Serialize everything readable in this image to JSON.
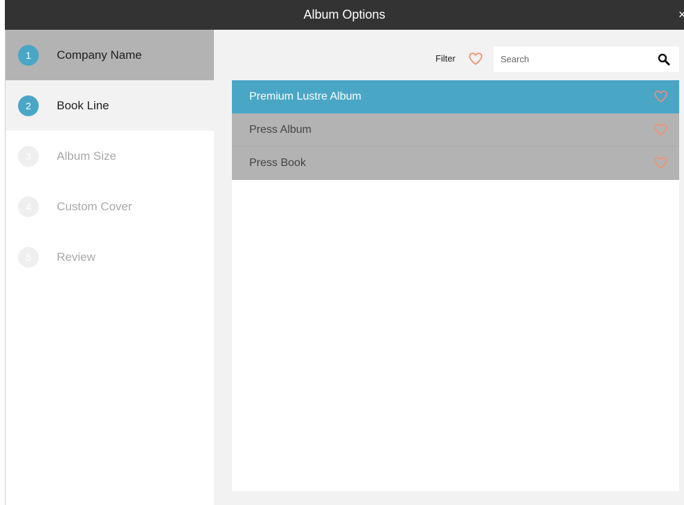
{
  "header": {
    "title": "Album Options",
    "close_label": "×"
  },
  "steps": [
    {
      "number": "1",
      "label": "Company Name",
      "state": "active"
    },
    {
      "number": "2",
      "label": "Book Line",
      "state": "done"
    },
    {
      "number": "3",
      "label": "Album Size",
      "state": "pending"
    },
    {
      "number": "4",
      "label": "Custom Cover",
      "state": "pending"
    },
    {
      "number": "5",
      "label": "Review",
      "state": "pending"
    }
  ],
  "toolbar": {
    "filter_label": "Filter",
    "search_placeholder": "Search",
    "search_value": ""
  },
  "items": [
    {
      "name": "Premium Lustre Album",
      "selected": true,
      "favorite_icon": "heart-outline-icon"
    },
    {
      "name": "Press Album",
      "selected": false,
      "favorite_icon": "heart-outline-icon"
    },
    {
      "name": "Press Book",
      "selected": false,
      "favorite_icon": "heart-outline-icon"
    }
  ],
  "colors": {
    "header_bg": "#333333",
    "accent_blue": "#4aa6c5",
    "heart_orange": "#f2926f",
    "heart_on_selected": "#e88f7e",
    "active_step_bg": "#b3b3b3",
    "done_step_bg": "#f2f2f2",
    "list_item_bg": "#b3b3b3",
    "main_bg": "#f2f2f2"
  }
}
